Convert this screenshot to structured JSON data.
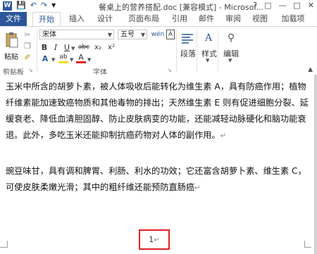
{
  "title_bar": {
    "document_title": "餐桌上的营养搭配.doc [兼容模式] - Microsof...",
    "help": "?",
    "minimize": "—",
    "restore": "□",
    "close": "✕"
  },
  "tabs": [
    "文件",
    "开始",
    "插入",
    "设计",
    "页面布局",
    "引用",
    "邮件",
    "审阅",
    "视图",
    "加载项"
  ],
  "ribbon": {
    "clipboard_label": "剪贴板",
    "paste_label": "粘贴",
    "font_name": "宋体",
    "font_size": "五号",
    "wen_button": "wén",
    "char_a_label": "A",
    "bold": "B",
    "italic": "I",
    "underline": "U",
    "strike": "abc",
    "subscript": "x₂",
    "superscript": "x²",
    "highlight_label": "ab",
    "font_color": "A",
    "font_group_label": "字体",
    "paragraph_label": "段落",
    "styles_label": "样式",
    "editing_label": "编辑"
  },
  "document": {
    "paragraph1": "玉米中所含的胡萝卜素，被人体吸收后能转化为维生素 A，具有防癌作用；植物纤维素能加速致癌物质和其他毒物的排出；天然维生素 E 则有促进细胞分裂、延缓衰老、降低血清胆固醇、防止皮肤病变的功能，还能减轻动脉硬化和脑功能衰退。此外，多吃玉米还能抑制抗癌药物对人体的副作用。",
    "paragraph2": "豌豆味甘，具有调和脾胃、利肠、利水的功效；它还富含胡萝卜素、维生素 C，可使皮肤柔嫩光滑；其中的粗纤维还能预防直肠癌",
    "page_number": "1"
  },
  "colors": {
    "accent": "#2b579a",
    "highlight_box": "#e02020",
    "font_color_bar": "#e02020",
    "highlight_bar": "#f5e11b"
  }
}
